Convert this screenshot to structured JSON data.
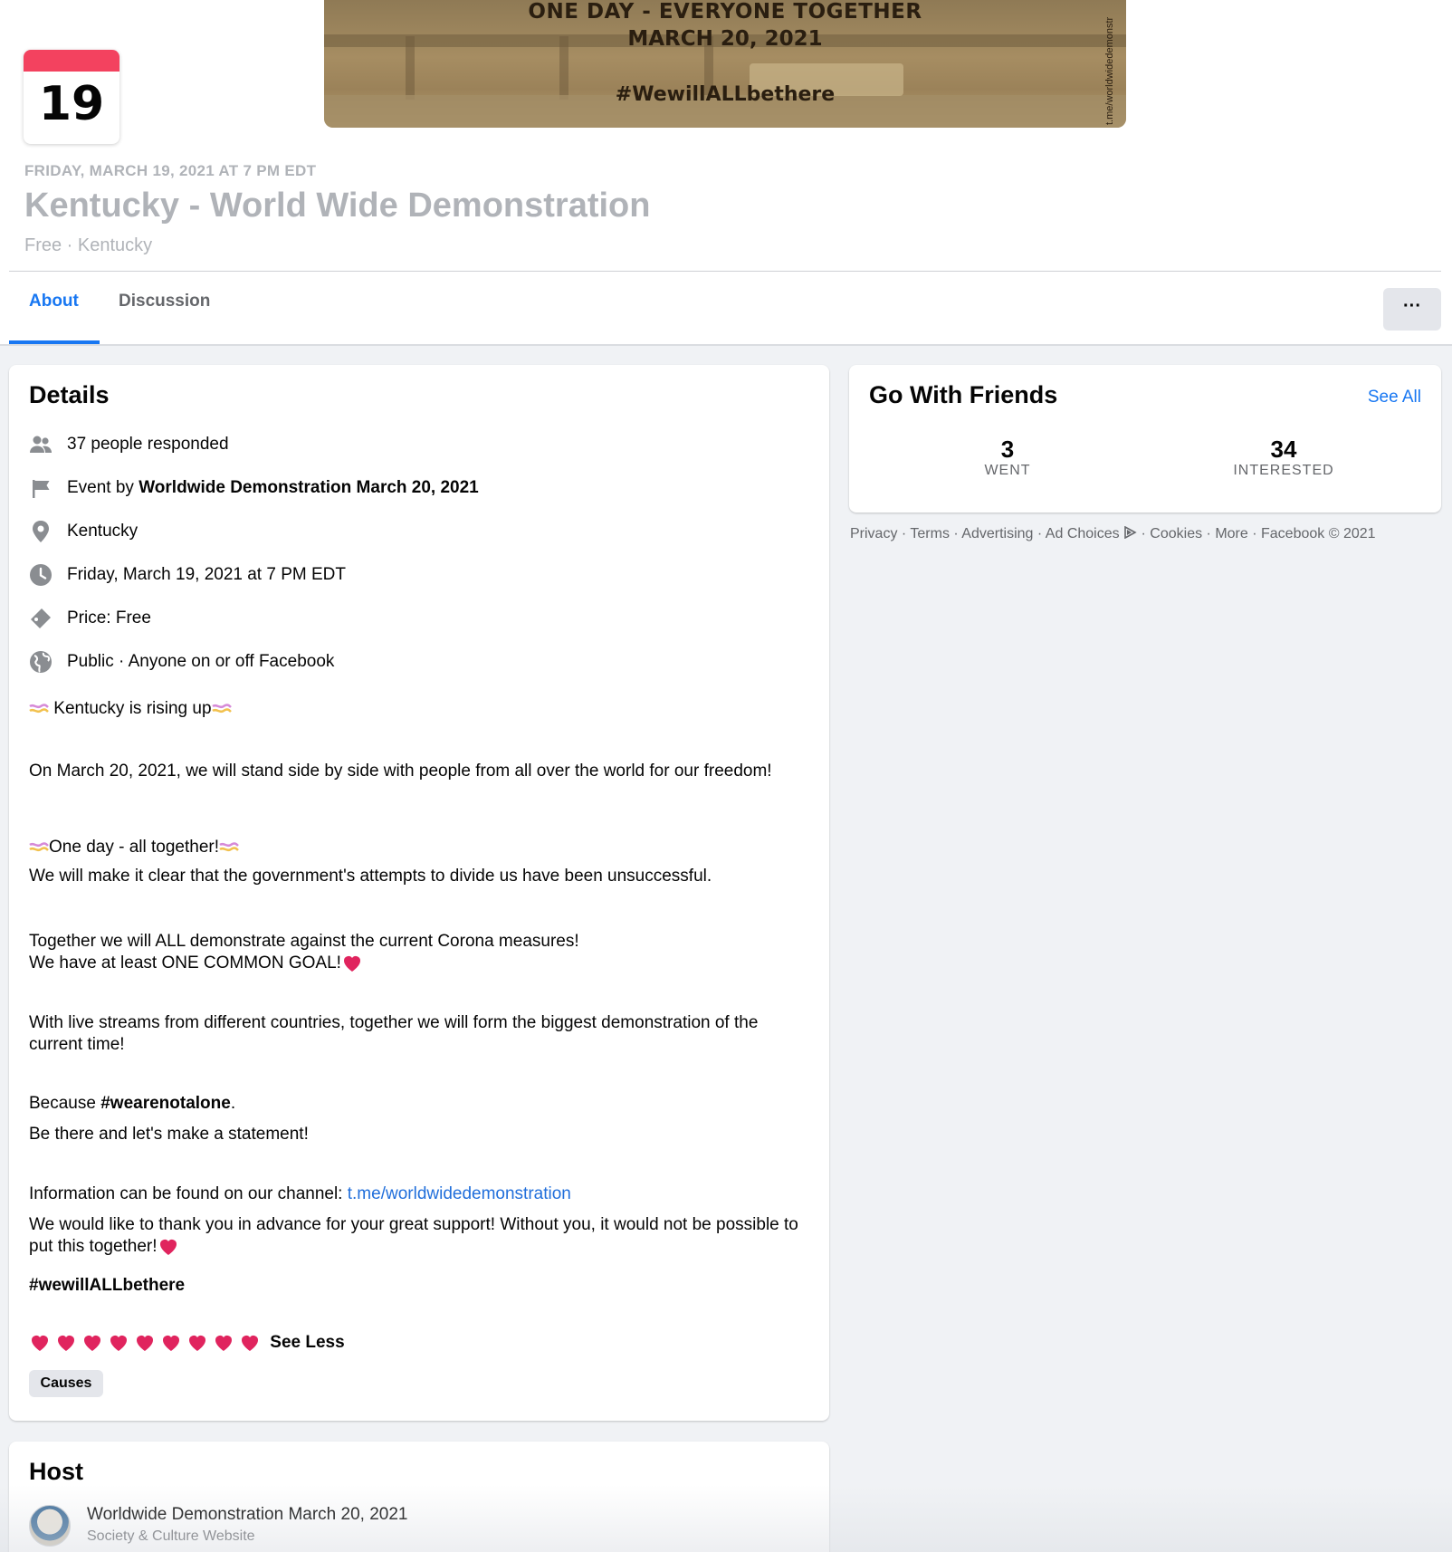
{
  "banner": {
    "line1": "ONE DAY - EVERYONE TOGETHER",
    "line2": "MARCH 20, 2021",
    "line3": "#WewillALLbethere",
    "side_text": "t.me/worldwidedemonstr"
  },
  "event": {
    "calendar_day": "19",
    "datetime_header": "FRIDAY, MARCH 19, 2021 AT 7 PM EDT",
    "title": "Kentucky - World Wide Demonstration",
    "subtitle": "Free · Kentucky"
  },
  "tabs": [
    {
      "label": "About",
      "active": true
    },
    {
      "label": "Discussion",
      "active": false
    }
  ],
  "more_button": "···",
  "details": {
    "heading": "Details",
    "rows": [
      {
        "icon": "people-icon",
        "text": "37 people responded"
      },
      {
        "icon": "flag-icon",
        "prefix": "Event by ",
        "bold": "Worldwide Demonstration March 20, 2021"
      },
      {
        "icon": "location-pin-icon",
        "text": "Kentucky"
      },
      {
        "icon": "clock-icon",
        "text": "Friday, March 19, 2021 at 7 PM EDT"
      },
      {
        "icon": "ticket-icon",
        "text": "Price: Free"
      },
      {
        "icon": "globe-icon",
        "text": "Public · Anyone on or off Facebook"
      }
    ],
    "desc": {
      "rising": "Kentucky is rising up",
      "p1": "On March 20, 2021, we will stand side by side with people from all over the world for our freedom!",
      "one_day": "One day - all together!",
      "p2": "We will make it clear that the government's attempts to divide us have been unsuccessful.",
      "p3a": "Together we will ALL demonstrate against the current Corona measures!",
      "p3b": "We have at least ONE COMMON GOAL!",
      "p4": "With live streams from different countries, together we will form the biggest demonstration of the current time!",
      "because_prefix": "Because ",
      "because_tag": "#wearenotalone",
      "because_suffix": ".",
      "p5": "Be there and let's make a statement!",
      "info_prefix": "Information can be found on our channel: ",
      "info_link": "t.me/worldwidedemonstration",
      "p6": "We would like to thank you in advance for your great support! Without you, it would not be possible to put this together!",
      "hashtag": "#wewillALLbethere",
      "see_less": "See Less",
      "heart_count": 9
    },
    "category_tag": "Causes"
  },
  "friends": {
    "heading": "Go With Friends",
    "see_all": "See All",
    "went_count": "3",
    "went_label": "WENT",
    "interested_count": "34",
    "interested_label": "INTERESTED"
  },
  "footer": {
    "links": [
      "Privacy",
      "Terms",
      "Advertising",
      "Ad Choices",
      "Cookies",
      "More"
    ],
    "copyright": "Facebook © 2021"
  },
  "host": {
    "heading": "Host",
    "name": "Worldwide Demonstration March 20, 2021",
    "category": "Society & Culture Website"
  },
  "colors": {
    "accent": "#1877f2",
    "calendar_red": "#f3425f",
    "muted_title": "#b0b3b8",
    "heart_red": "#e0245e"
  }
}
